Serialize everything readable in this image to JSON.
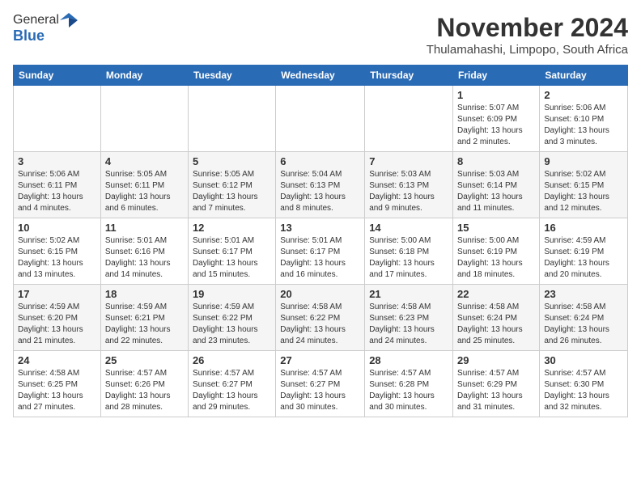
{
  "header": {
    "logo_general": "General",
    "logo_blue": "Blue",
    "month_title": "November 2024",
    "location": "Thulamahashi, Limpopo, South Africa"
  },
  "weekdays": [
    "Sunday",
    "Monday",
    "Tuesday",
    "Wednesday",
    "Thursday",
    "Friday",
    "Saturday"
  ],
  "weeks": [
    [
      {
        "day": "",
        "info": ""
      },
      {
        "day": "",
        "info": ""
      },
      {
        "day": "",
        "info": ""
      },
      {
        "day": "",
        "info": ""
      },
      {
        "day": "",
        "info": ""
      },
      {
        "day": "1",
        "info": "Sunrise: 5:07 AM\nSunset: 6:09 PM\nDaylight: 13 hours\nand 2 minutes."
      },
      {
        "day": "2",
        "info": "Sunrise: 5:06 AM\nSunset: 6:10 PM\nDaylight: 13 hours\nand 3 minutes."
      }
    ],
    [
      {
        "day": "3",
        "info": "Sunrise: 5:06 AM\nSunset: 6:11 PM\nDaylight: 13 hours\nand 4 minutes."
      },
      {
        "day": "4",
        "info": "Sunrise: 5:05 AM\nSunset: 6:11 PM\nDaylight: 13 hours\nand 6 minutes."
      },
      {
        "day": "5",
        "info": "Sunrise: 5:05 AM\nSunset: 6:12 PM\nDaylight: 13 hours\nand 7 minutes."
      },
      {
        "day": "6",
        "info": "Sunrise: 5:04 AM\nSunset: 6:13 PM\nDaylight: 13 hours\nand 8 minutes."
      },
      {
        "day": "7",
        "info": "Sunrise: 5:03 AM\nSunset: 6:13 PM\nDaylight: 13 hours\nand 9 minutes."
      },
      {
        "day": "8",
        "info": "Sunrise: 5:03 AM\nSunset: 6:14 PM\nDaylight: 13 hours\nand 11 minutes."
      },
      {
        "day": "9",
        "info": "Sunrise: 5:02 AM\nSunset: 6:15 PM\nDaylight: 13 hours\nand 12 minutes."
      }
    ],
    [
      {
        "day": "10",
        "info": "Sunrise: 5:02 AM\nSunset: 6:15 PM\nDaylight: 13 hours\nand 13 minutes."
      },
      {
        "day": "11",
        "info": "Sunrise: 5:01 AM\nSunset: 6:16 PM\nDaylight: 13 hours\nand 14 minutes."
      },
      {
        "day": "12",
        "info": "Sunrise: 5:01 AM\nSunset: 6:17 PM\nDaylight: 13 hours\nand 15 minutes."
      },
      {
        "day": "13",
        "info": "Sunrise: 5:01 AM\nSunset: 6:17 PM\nDaylight: 13 hours\nand 16 minutes."
      },
      {
        "day": "14",
        "info": "Sunrise: 5:00 AM\nSunset: 6:18 PM\nDaylight: 13 hours\nand 17 minutes."
      },
      {
        "day": "15",
        "info": "Sunrise: 5:00 AM\nSunset: 6:19 PM\nDaylight: 13 hours\nand 18 minutes."
      },
      {
        "day": "16",
        "info": "Sunrise: 4:59 AM\nSunset: 6:19 PM\nDaylight: 13 hours\nand 20 minutes."
      }
    ],
    [
      {
        "day": "17",
        "info": "Sunrise: 4:59 AM\nSunset: 6:20 PM\nDaylight: 13 hours\nand 21 minutes."
      },
      {
        "day": "18",
        "info": "Sunrise: 4:59 AM\nSunset: 6:21 PM\nDaylight: 13 hours\nand 22 minutes."
      },
      {
        "day": "19",
        "info": "Sunrise: 4:59 AM\nSunset: 6:22 PM\nDaylight: 13 hours\nand 23 minutes."
      },
      {
        "day": "20",
        "info": "Sunrise: 4:58 AM\nSunset: 6:22 PM\nDaylight: 13 hours\nand 24 minutes."
      },
      {
        "day": "21",
        "info": "Sunrise: 4:58 AM\nSunset: 6:23 PM\nDaylight: 13 hours\nand 24 minutes."
      },
      {
        "day": "22",
        "info": "Sunrise: 4:58 AM\nSunset: 6:24 PM\nDaylight: 13 hours\nand 25 minutes."
      },
      {
        "day": "23",
        "info": "Sunrise: 4:58 AM\nSunset: 6:24 PM\nDaylight: 13 hours\nand 26 minutes."
      }
    ],
    [
      {
        "day": "24",
        "info": "Sunrise: 4:58 AM\nSunset: 6:25 PM\nDaylight: 13 hours\nand 27 minutes."
      },
      {
        "day": "25",
        "info": "Sunrise: 4:57 AM\nSunset: 6:26 PM\nDaylight: 13 hours\nand 28 minutes."
      },
      {
        "day": "26",
        "info": "Sunrise: 4:57 AM\nSunset: 6:27 PM\nDaylight: 13 hours\nand 29 minutes."
      },
      {
        "day": "27",
        "info": "Sunrise: 4:57 AM\nSunset: 6:27 PM\nDaylight: 13 hours\nand 30 minutes."
      },
      {
        "day": "28",
        "info": "Sunrise: 4:57 AM\nSunset: 6:28 PM\nDaylight: 13 hours\nand 30 minutes."
      },
      {
        "day": "29",
        "info": "Sunrise: 4:57 AM\nSunset: 6:29 PM\nDaylight: 13 hours\nand 31 minutes."
      },
      {
        "day": "30",
        "info": "Sunrise: 4:57 AM\nSunset: 6:30 PM\nDaylight: 13 hours\nand 32 minutes."
      }
    ]
  ]
}
